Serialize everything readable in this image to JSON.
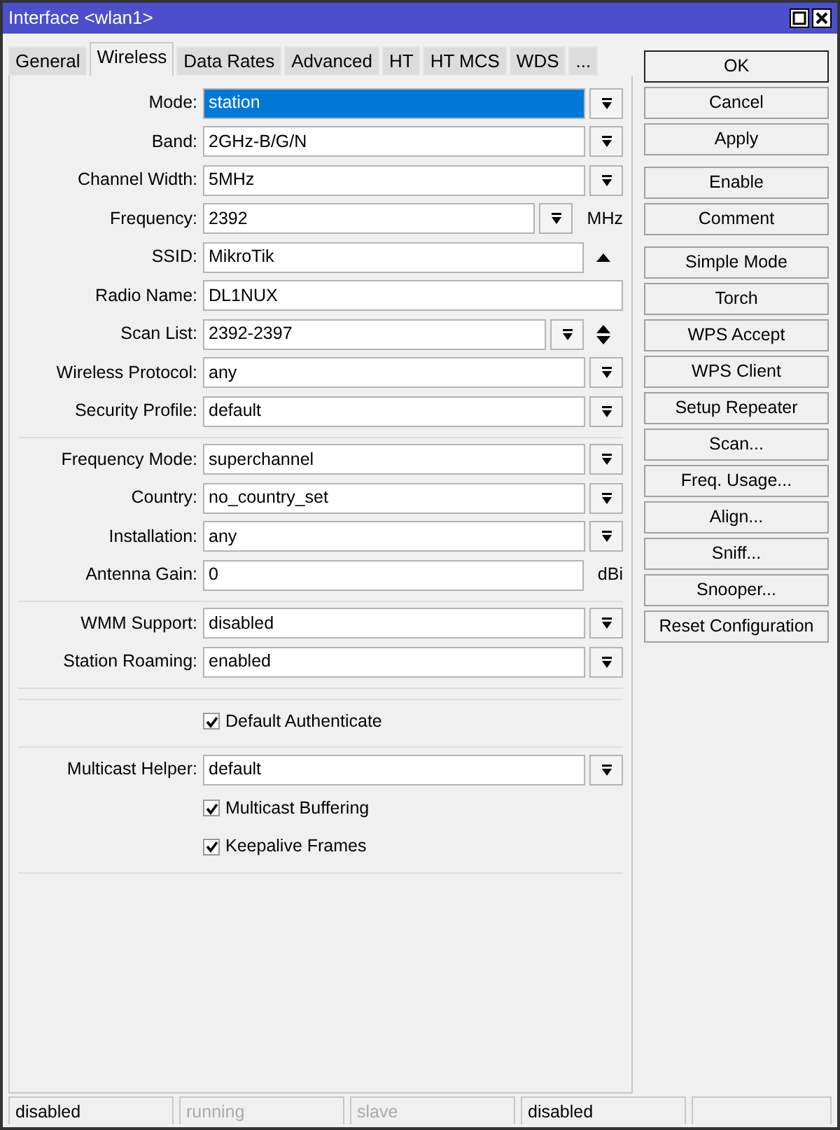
{
  "window": {
    "title": "Interface <wlan1>"
  },
  "tabs": [
    {
      "label": "General",
      "selected": false
    },
    {
      "label": "Wireless",
      "selected": true
    },
    {
      "label": "Data Rates",
      "selected": false
    },
    {
      "label": "Advanced",
      "selected": false
    },
    {
      "label": "HT",
      "selected": false
    },
    {
      "label": "HT MCS",
      "selected": false
    },
    {
      "label": "WDS",
      "selected": false
    },
    {
      "label": "...",
      "selected": false
    }
  ],
  "sections": [
    {
      "rows": [
        {
          "kind": "select",
          "label": "Mode:",
          "value": "station",
          "selected": true
        },
        {
          "kind": "select",
          "label": "Band:",
          "value": "2GHz-B/G/N",
          "selected": false
        },
        {
          "kind": "select",
          "label": "Channel Width:",
          "value": "5MHz",
          "selected": false
        },
        {
          "kind": "select",
          "label": "Frequency:",
          "value": "2392",
          "unit": "MHz",
          "selected": false
        },
        {
          "kind": "collapsible",
          "label": "SSID:",
          "value": "MikroTik"
        },
        {
          "kind": "text",
          "label": "Radio Name:",
          "value": "DL1NUX"
        },
        {
          "kind": "multi",
          "label": "Scan List:",
          "value": "2392-2397"
        },
        {
          "kind": "select",
          "label": "Wireless Protocol:",
          "value": "any",
          "selected": false
        },
        {
          "kind": "select",
          "label": "Security Profile:",
          "value": "default",
          "selected": false
        }
      ]
    },
    {
      "rows": [
        {
          "kind": "select",
          "label": "Frequency Mode:",
          "value": "superchannel",
          "selected": false
        },
        {
          "kind": "select",
          "label": "Country:",
          "value": "no_country_set",
          "selected": false
        },
        {
          "kind": "select",
          "label": "Installation:",
          "value": "any",
          "selected": false
        },
        {
          "kind": "text",
          "label": "Antenna Gain:",
          "value": "0",
          "unit": "dBi"
        }
      ]
    },
    {
      "rows": [
        {
          "kind": "select",
          "label": "WMM Support:",
          "value": "disabled",
          "selected": false
        },
        {
          "kind": "select",
          "label": "Station Roaming:",
          "value": "enabled",
          "selected": false
        }
      ]
    },
    {
      "spacer": true,
      "rows": [
        {
          "kind": "checkbox",
          "label": "Default Authenticate",
          "checked": true
        }
      ]
    },
    {
      "rows": [
        {
          "kind": "select",
          "label": "Multicast Helper:",
          "value": "default",
          "selected": false
        },
        {
          "kind": "checkbox",
          "label": "Multicast Buffering",
          "checked": true
        },
        {
          "kind": "checkbox",
          "label": "Keepalive Frames",
          "checked": true
        }
      ]
    }
  ],
  "button_groups": [
    [
      {
        "label": "OK",
        "default": true
      },
      {
        "label": "Cancel",
        "default": false
      },
      {
        "label": "Apply",
        "default": false
      }
    ],
    [
      {
        "label": "Enable",
        "default": false
      },
      {
        "label": "Comment",
        "default": false
      }
    ],
    [
      {
        "label": "Simple Mode",
        "default": false
      },
      {
        "label": "Torch",
        "default": false
      },
      {
        "label": "WPS Accept",
        "default": false
      },
      {
        "label": "WPS Client",
        "default": false
      },
      {
        "label": "Setup Repeater",
        "default": false
      },
      {
        "label": "Scan...",
        "default": false
      },
      {
        "label": "Freq. Usage...",
        "default": false
      },
      {
        "label": "Align...",
        "default": false
      },
      {
        "label": "Sniff...",
        "default": false
      },
      {
        "label": "Snooper...",
        "default": false
      },
      {
        "label": "Reset Configuration",
        "default": false
      }
    ]
  ],
  "status_bar": [
    {
      "text": "disabled",
      "disabled": false
    },
    {
      "text": "running",
      "disabled": true
    },
    {
      "text": "slave",
      "disabled": true
    },
    {
      "text": "disabled",
      "disabled": false
    }
  ]
}
